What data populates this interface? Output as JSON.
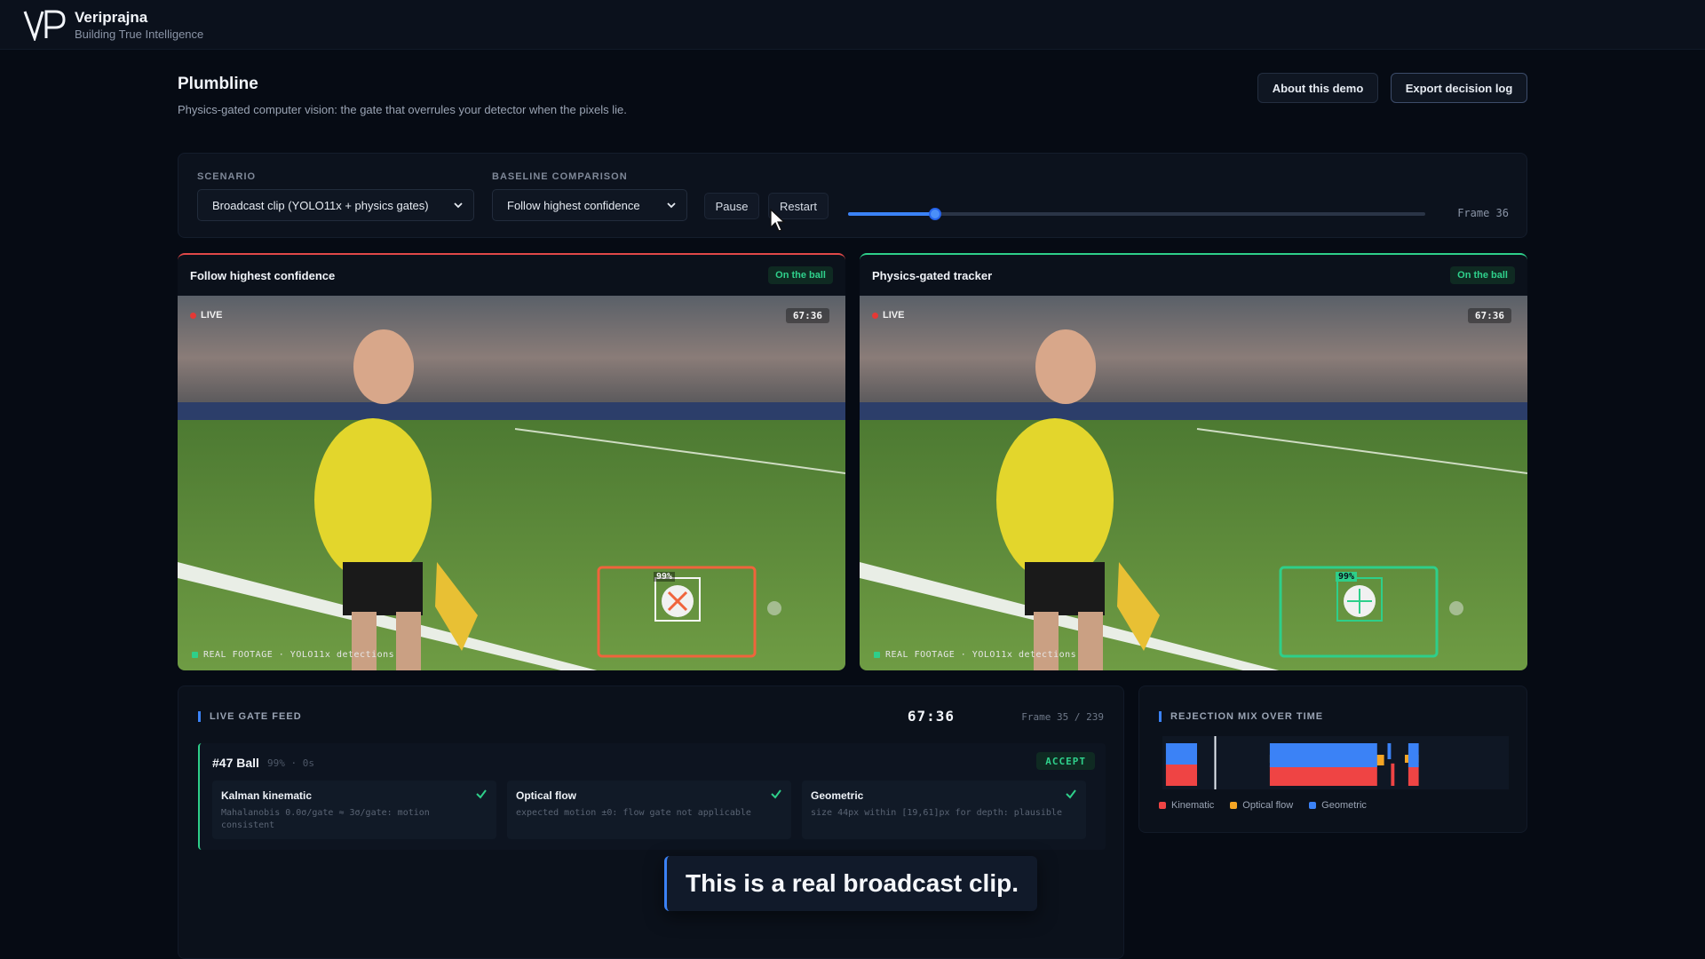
{
  "app": {
    "name": "Veriprajna",
    "tagline": "Building True Intelligence"
  },
  "header": {
    "title": "Plumbline",
    "subtitle": "Physics-gated computer vision: the gate that overrules your detector when the pixels lie.",
    "about_label": "About this demo",
    "export_label": "Export decision log"
  },
  "controls": {
    "scenario_label": "SCENARIO",
    "scenario_value": "Broadcast clip (YOLO11x + physics gates)",
    "baseline_label": "BASELINE COMPARISON",
    "baseline_value": "Follow highest confidence",
    "pause_label": "Pause",
    "restart_label": "Restart",
    "frame_readout": "Frame 36",
    "progress_fraction": 0.15
  },
  "panels": [
    {
      "title": "Follow highest confidence",
      "status": "On the ball",
      "accent": "#e04848",
      "box_color": "#f0643c",
      "live": "LIVE",
      "clock": "67:36",
      "confidence": "99%",
      "footage": "REAL FOOTAGE · YOLO11x detections"
    },
    {
      "title": "Physics-gated tracker",
      "status": "On the ball",
      "accent": "#2ecf8a",
      "box_color": "#2ecf8a",
      "live": "LIVE",
      "clock": "67:36",
      "confidence": "99%",
      "footage": "REAL FOOTAGE · YOLO11x detections"
    }
  ],
  "feed": {
    "title": "LIVE GATE FEED",
    "clock": "67:36",
    "frame": "Frame 35 / 239",
    "detection": {
      "id": "#47 Ball",
      "meta": "99% · 0s",
      "verdict": "ACCEPT"
    },
    "gates": [
      {
        "name": "Kalman kinematic",
        "detail": "Mahalanobis 0.0σ/gate ≈ 3σ/gate: motion consistent",
        "pass": true
      },
      {
        "name": "Optical flow",
        "detail": "expected motion ±0: flow gate not applicable",
        "pass": true
      },
      {
        "name": "Geometric",
        "detail": "size 44px within [19,61]px for depth: plausible",
        "pass": true
      }
    ]
  },
  "caption": "This is a real broadcast clip.",
  "mix": {
    "title": "REJECTION MIX OVER TIME",
    "legend": [
      {
        "label": "Kinematic",
        "color": "#ef4444"
      },
      {
        "label": "Optical flow",
        "color": "#f5a524"
      },
      {
        "label": "Geometric",
        "color": "#3b82f6"
      }
    ]
  },
  "chart_data": {
    "type": "area",
    "title": "REJECTION MIX OVER TIME",
    "x_frames": 239,
    "current_frame_fraction": 0.15,
    "series": [
      {
        "name": "Kinematic",
        "segments": [
          [
            0.01,
            0.1,
            0.6
          ],
          [
            0.31,
            0.62,
            0.55
          ],
          [
            0.66,
            0.67,
            0.6
          ],
          [
            0.71,
            0.74,
            0.6
          ]
        ]
      },
      {
        "name": "Optical flow",
        "segments": [
          [
            0.31,
            0.62,
            0.15
          ],
          [
            0.47,
            0.64,
            0.2
          ],
          [
            0.7,
            0.74,
            0.15
          ]
        ]
      },
      {
        "name": "Geometric",
        "segments": [
          [
            0.01,
            0.1,
            0.4
          ],
          [
            0.31,
            0.62,
            0.45
          ],
          [
            0.65,
            0.66,
            0.3
          ],
          [
            0.71,
            0.74,
            0.45
          ]
        ]
      }
    ]
  }
}
